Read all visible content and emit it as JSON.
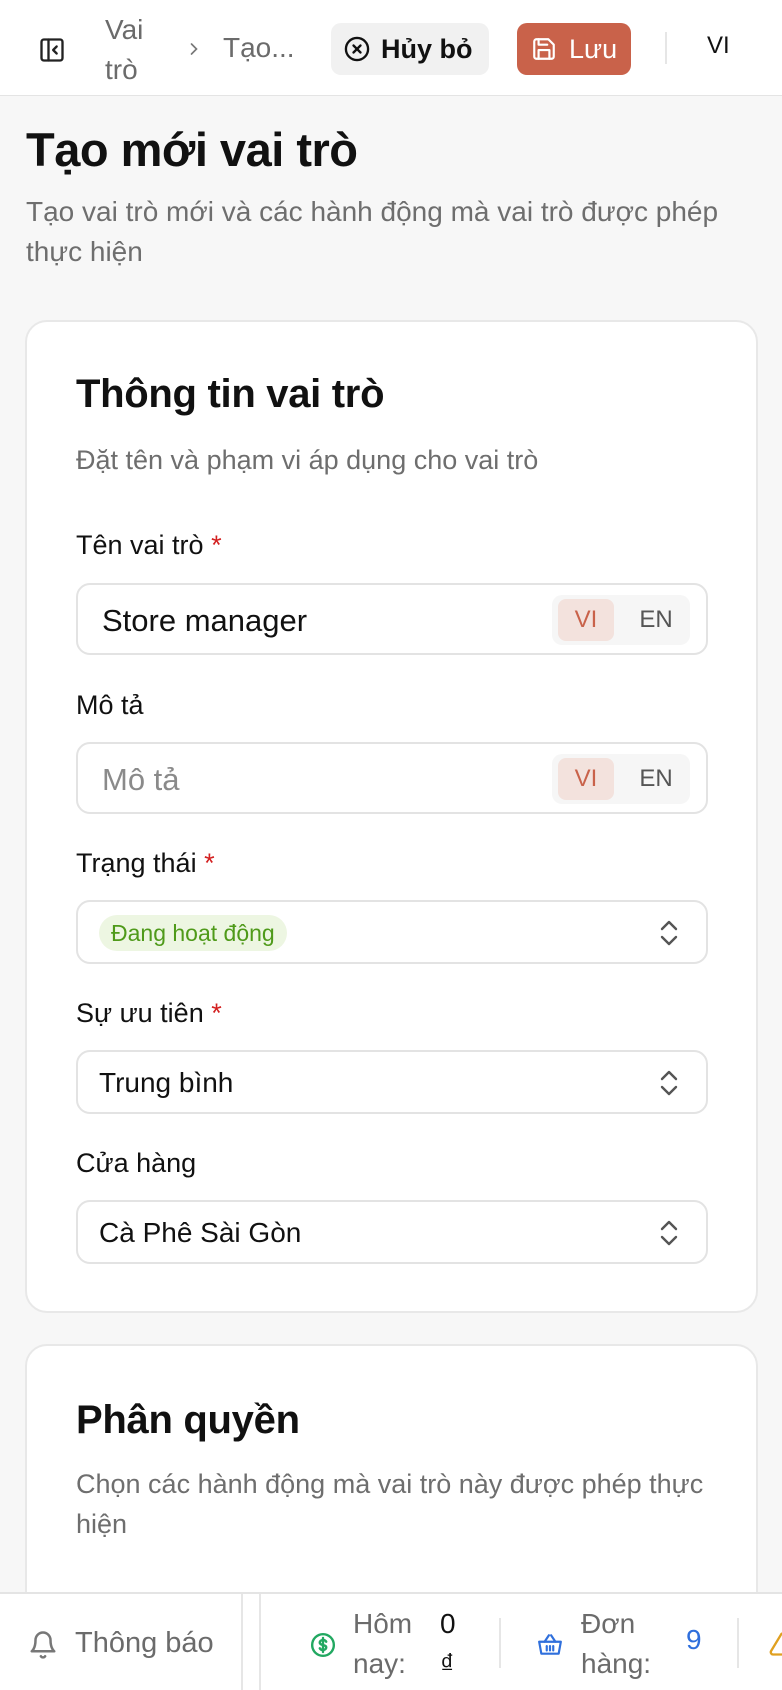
{
  "header": {
    "breadcrumb": [
      "Vai trò",
      "Tạo..."
    ],
    "cancel_label": "Hủy bỏ",
    "save_label": "Lưu",
    "language": "VI"
  },
  "page": {
    "title": "Tạo mới vai trò",
    "subtitle": "Tạo vai trò mới và các hành động mà vai trò được phép thực hiện"
  },
  "role_info": {
    "title": "Thông tin vai trò",
    "subtitle": "Đặt tên và phạm vi áp dụng cho vai trò",
    "name": {
      "label": "Tên vai trò",
      "required": "*",
      "value": "Store manager",
      "lang_vi": "VI",
      "lang_en": "EN",
      "active_lang": "VI"
    },
    "description": {
      "label": "Mô tả",
      "placeholder": "Mô tả",
      "lang_vi": "VI",
      "lang_en": "EN",
      "active_lang": "VI"
    },
    "status": {
      "label": "Trạng thái",
      "required": "*",
      "value": "Đang hoạt động",
      "color": "#4f9a1a"
    },
    "priority": {
      "label": "Sự ưu tiên",
      "required": "*",
      "value": "Trung bình"
    },
    "store": {
      "label": "Cửa hàng",
      "value": "Cà Phê Sài Gòn"
    }
  },
  "permissions": {
    "title": "Phân quyền",
    "subtitle": "Chọn các hành động mà vai trò này được phép thực hiện"
  },
  "bottom_bar": {
    "notifications": "Thông báo",
    "today_label": "Hôm nay:",
    "today_value": "0 ₫",
    "orders_label": "Đơn hàng:",
    "orders_value": "9"
  },
  "colors": {
    "accent": "#c9624a",
    "required": "#d32020",
    "orders_value": "#2f6fdc",
    "money_icon": "#22a861",
    "warning_icon": "#e0a020"
  },
  "icons": [
    "sidebar-toggle-icon",
    "chevron-right-icon",
    "x-circle-icon",
    "save-icon",
    "chevrons-up-down-icon",
    "bell-icon",
    "money-icon",
    "basket-icon",
    "warning-icon"
  ]
}
